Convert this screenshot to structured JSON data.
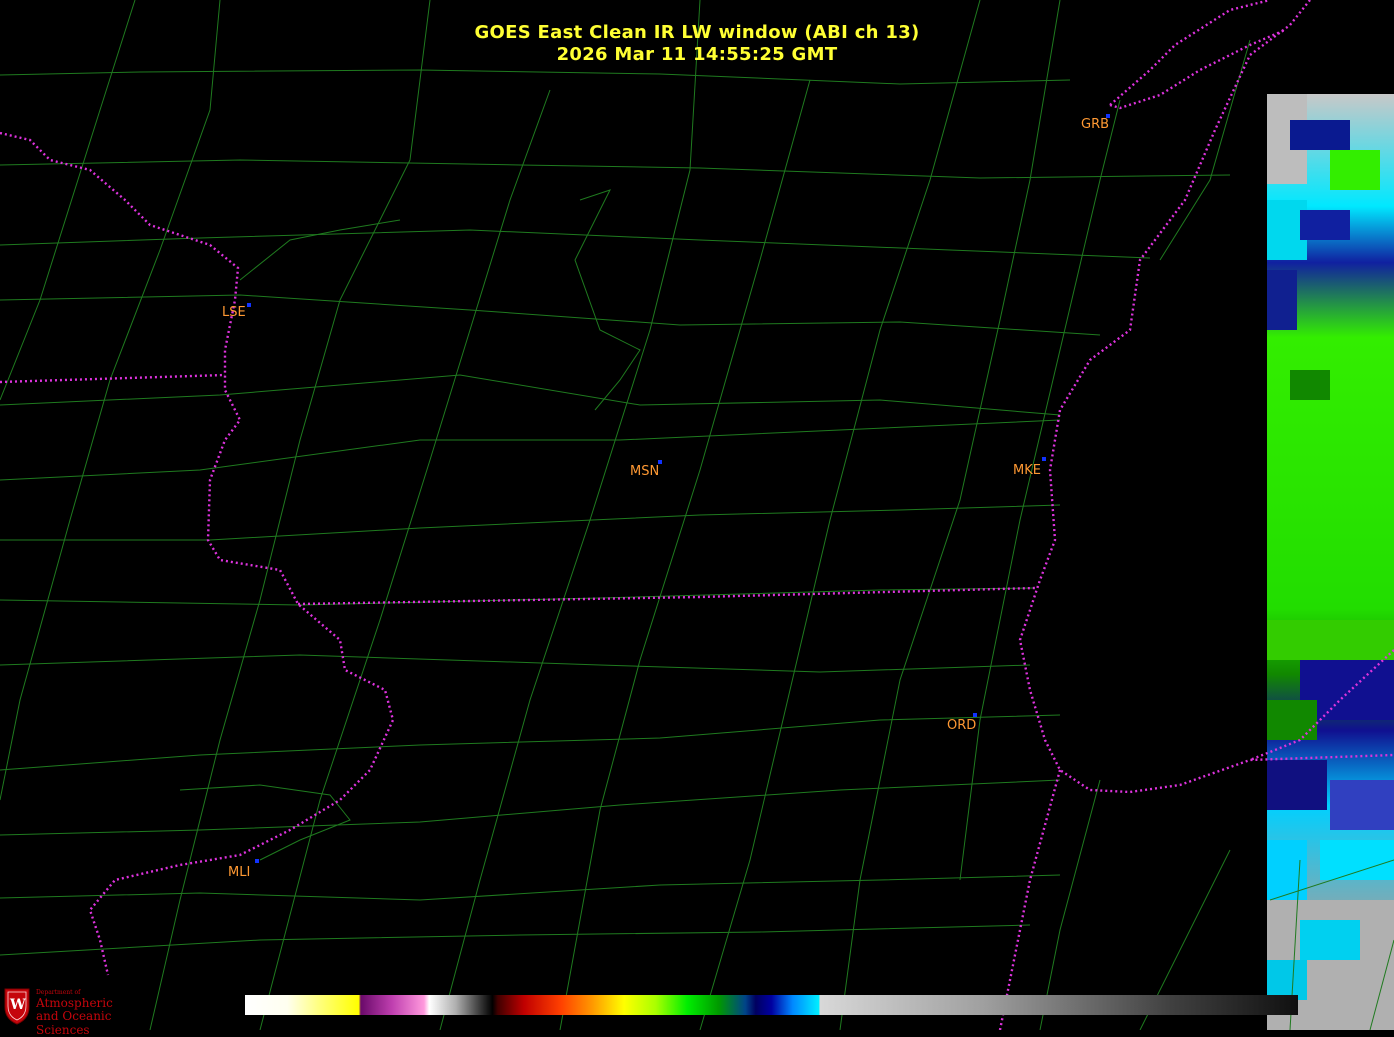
{
  "title": {
    "line1": "GOES East Clean IR LW window (ABI ch 13)",
    "line2": "2026 Mar 11  14:55:25 GMT"
  },
  "stations": [
    {
      "id": "GRB"
    },
    {
      "id": "LSE"
    },
    {
      "id": "MSN"
    },
    {
      "id": "MKE"
    },
    {
      "id": "ORD"
    },
    {
      "id": "MLI"
    }
  ],
  "logo": {
    "line_small": "Department of",
    "line1": "Atmospheric",
    "line2": "and Oceanic Sciences",
    "emblem": "W"
  },
  "colors": {
    "title": "#ffff33",
    "station_label": "#ff9933",
    "station_dot": "#1133ff",
    "county_lines": "#1f7a1f",
    "state_lines": "#dd33dd"
  },
  "colorbar": {
    "type": "ir-temperature-enhancement",
    "tick_labels": []
  }
}
